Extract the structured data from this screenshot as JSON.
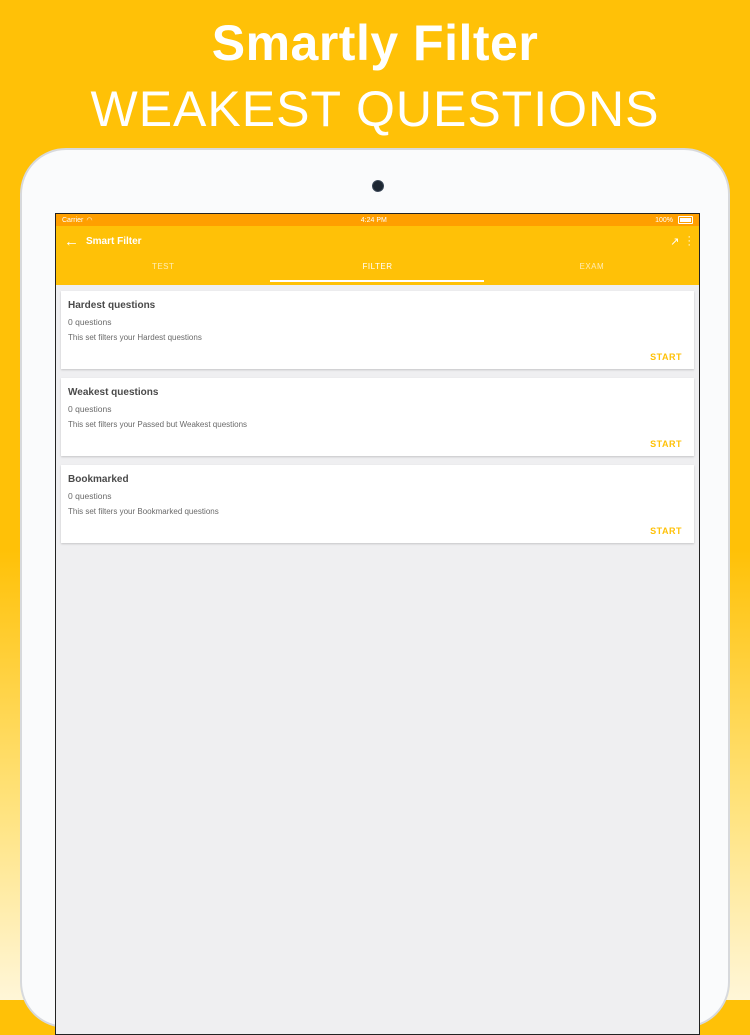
{
  "banner": {
    "line1": "Smartly Filter",
    "line2": "WEAKEST QUESTIONS"
  },
  "statusbar": {
    "carrier": "Carrier",
    "time": "4:24 PM",
    "battery": "100%"
  },
  "appbar": {
    "title": "Smart Filter",
    "icons": {
      "back": "arrow-back-icon",
      "trend": "trending-icon",
      "more": "more-vert-icon"
    }
  },
  "tabs": [
    {
      "label": "TEST"
    },
    {
      "label": "FILTER",
      "active": true
    },
    {
      "label": "EXAM"
    }
  ],
  "cards": [
    {
      "title": "Hardest questions",
      "count": "0 questions",
      "desc": "This set filters your Hardest questions",
      "action": "START"
    },
    {
      "title": "Weakest questions",
      "count": "0 questions",
      "desc": "This set filters your Passed but Weakest questions",
      "action": "START"
    },
    {
      "title": "Bookmarked",
      "count": "0 questions",
      "desc": "This set filters your Bookmarked questions",
      "action": "START"
    }
  ],
  "colors": {
    "accent": "#FFC107",
    "statusbar": "#FF9F00",
    "background": "#EFEFF1"
  }
}
